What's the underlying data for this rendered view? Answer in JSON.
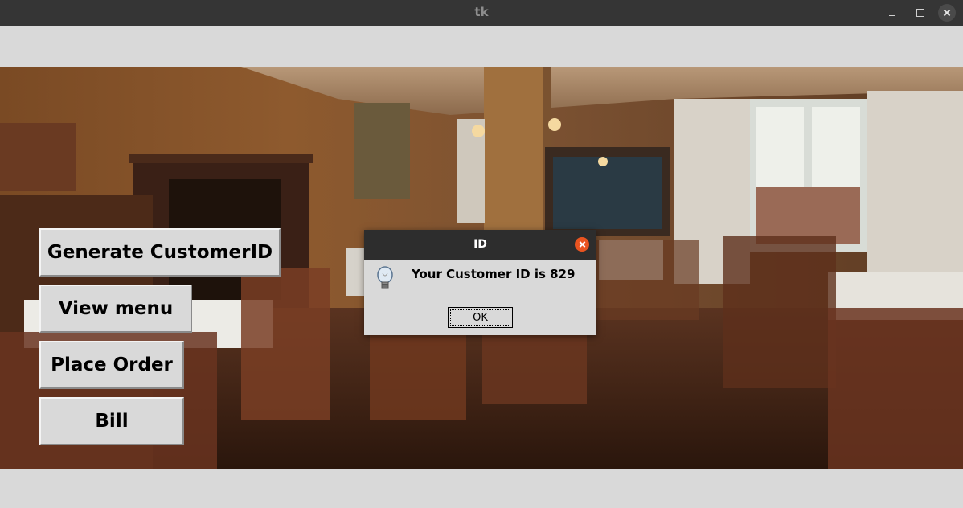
{
  "window": {
    "title": "tk"
  },
  "buttons": {
    "generate": "Generate CustomerID",
    "view_menu": "View menu",
    "place_order": "Place Order",
    "bill": "Bill"
  },
  "dialog": {
    "title": "ID",
    "message": "Your Customer ID is 829",
    "ok_first": "O",
    "ok_rest": "K",
    "icon": "lightbulb-icon"
  },
  "colors": {
    "titlebar": "#353535",
    "window_bg": "#d9d9d9",
    "dialog_close": "#e95420"
  }
}
